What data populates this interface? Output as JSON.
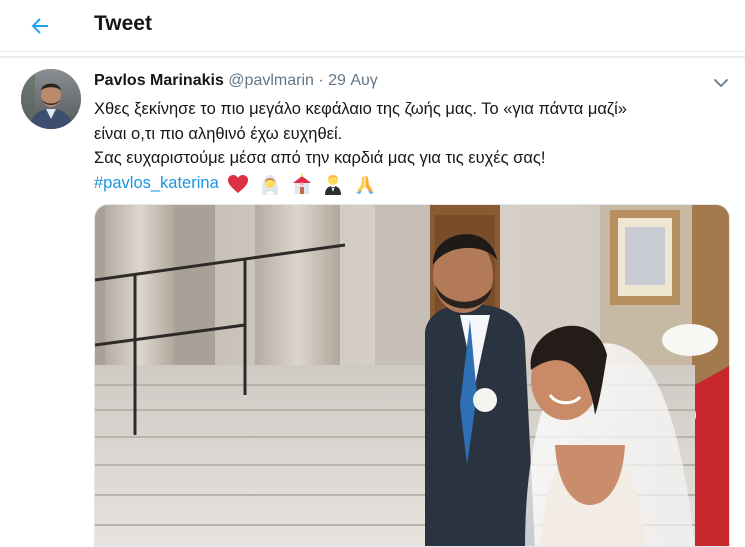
{
  "header": {
    "title": "Tweet",
    "back_icon": "arrow-left-icon",
    "accent_color": "#1da1f2"
  },
  "tweet": {
    "author_name": "Pavlos Marinakis",
    "author_handle": "@pavlmarin",
    "separator": "·",
    "date": "29 Αυγ",
    "text_line_1": "Χθες ξεκίνησε το πιο μεγάλο κεφάλαιο της ζωής μας. Το «για πάντα μαζί»",
    "text_line_2": "είναι ο,τι πιο αληθινό έχω ευχηθεί.",
    "text_line_3": "Σας ευχαριστούμε μέσα από την καρδιά μας για τις ευχές σας!",
    "hashtag": "#pavlos_katerina",
    "hashtag_color": "#1b95e0",
    "emojis": [
      "red-heart-icon",
      "bride-with-veil-icon",
      "wedding-chapel-icon",
      "man-in-tuxedo-icon",
      "folded-hands-icon"
    ],
    "menu_icon": "chevron-down-icon",
    "photo": "wedding-photo"
  }
}
